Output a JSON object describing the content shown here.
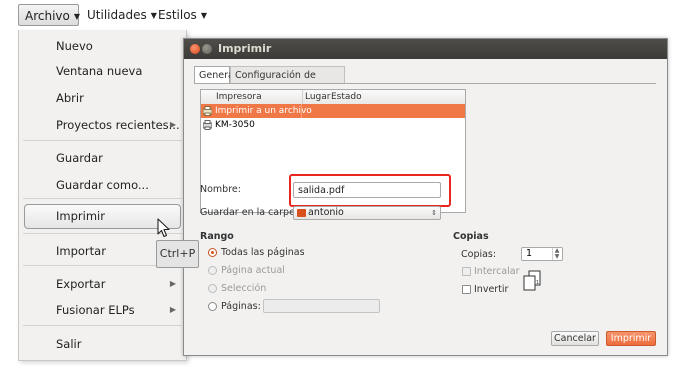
{
  "menubar": {
    "items": [
      {
        "label": "Archivo"
      },
      {
        "label": "Utilidades"
      },
      {
        "label": "Estilos"
      }
    ]
  },
  "file_menu": {
    "items": [
      {
        "label": "Nuevo"
      },
      {
        "label": "Ventana nueva"
      },
      {
        "label": "Abrir"
      },
      {
        "label": "Proyectos recientes..."
      },
      {
        "label": "Guardar"
      },
      {
        "label": "Guardar como..."
      },
      {
        "label": "Imprimir"
      },
      {
        "label": "Importar"
      },
      {
        "label": "Exportar"
      },
      {
        "label": "Fusionar ELPs"
      },
      {
        "label": "Salir"
      }
    ]
  },
  "tooltip": {
    "text": "Ctrl+P"
  },
  "dialog": {
    "title": "Imprimir",
    "tabs": [
      {
        "label": "General"
      },
      {
        "label": "Configuración de página"
      }
    ],
    "printer_list": {
      "columns": [
        "Impresora",
        "Lugar",
        "Estado"
      ],
      "rows": [
        {
          "name": "Imprimir a un archivo"
        },
        {
          "name": "KM-3050"
        }
      ]
    },
    "name_label": "Nombre:",
    "name_value": "salida.pdf",
    "folder_label": "Guardar en la carpeta:",
    "folder_value": "antonio",
    "range": {
      "title": "Rango",
      "all_pages": "Todas las páginas",
      "current_page": "Página actual",
      "selection": "Selección",
      "pages": "Páginas:"
    },
    "copies": {
      "title": "Copias",
      "copies_label": "Copias:",
      "copies_value": "1",
      "collate": "Intercalar",
      "reverse": "Invertir"
    },
    "buttons": {
      "cancel": "Cancelar",
      "print": "Imprimir"
    }
  },
  "colors": {
    "accent": "#f07746",
    "highlight_box": "#e8281e",
    "titlebar": "#3c3b37"
  }
}
